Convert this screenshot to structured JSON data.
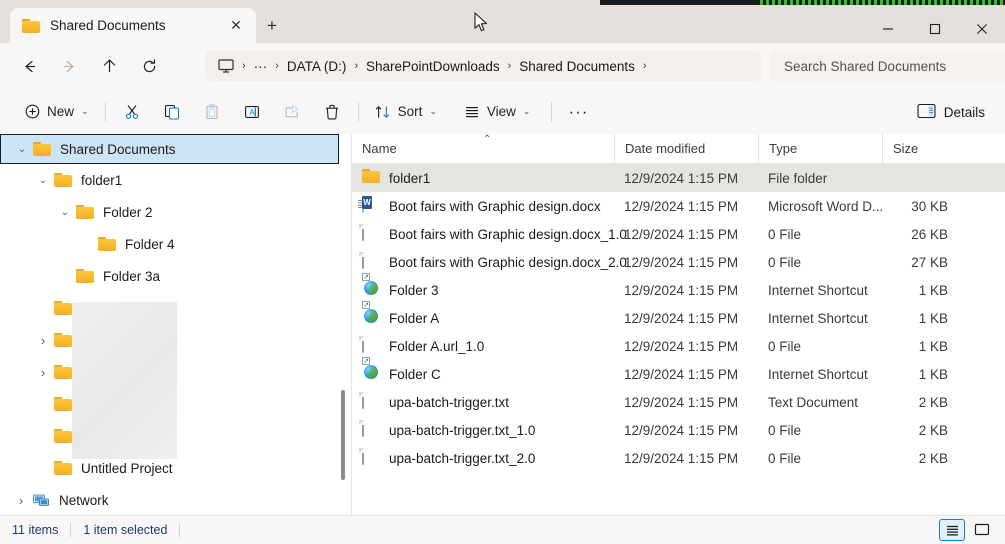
{
  "window": {
    "tab_title": "Shared Documents",
    "tab_folder_icon": "folder-icon",
    "close_tab_icon": "✕",
    "new_tab_icon": "+",
    "minimize_icon": "minimize-icon",
    "maximize_icon": "maximize-icon",
    "close_icon": "close-icon"
  },
  "nav": {
    "back_icon": "←",
    "forward_icon": "→",
    "up_icon": "↑",
    "refresh_icon": "⟳"
  },
  "breadcrumb": {
    "root_icon": "monitor-icon",
    "separator": "›",
    "overflow": "···",
    "items": [
      {
        "label": "DATA (D:)"
      },
      {
        "label": "SharePointDownloads"
      },
      {
        "label": "Shared Documents"
      }
    ]
  },
  "search": {
    "placeholder": "Search Shared Documents",
    "value": ""
  },
  "toolbar": {
    "new_label": "New",
    "new_icon": "plus-circle-icon",
    "cut_icon": "scissors-icon",
    "copy_icon": "copy-icon",
    "paste_icon": "paste-icon",
    "rename_icon": "rename-icon",
    "share_icon": "share-icon",
    "delete_icon": "trash-icon",
    "sort_label": "Sort",
    "sort_icon": "sort-arrows-icon",
    "view_label": "View",
    "view_icon": "view-lines-icon",
    "more_label": "···",
    "details_label": "Details",
    "details_icon": "details-pane-icon",
    "chevron": "⌄"
  },
  "sidebar": {
    "items": [
      {
        "label": "Shared Documents",
        "icon": "folder-icon",
        "indent": 0,
        "chevron": "expanded",
        "selected": true,
        "redacted": false
      },
      {
        "label": "folder1",
        "icon": "folder-icon",
        "indent": 1,
        "chevron": "expanded",
        "selected": false,
        "redacted": false
      },
      {
        "label": "Folder 2",
        "icon": "folder-icon",
        "indent": 2,
        "chevron": "expanded",
        "selected": false,
        "redacted": false
      },
      {
        "label": "Folder 4",
        "icon": "folder-icon",
        "indent": 3,
        "chevron": "none",
        "selected": false,
        "redacted": false
      },
      {
        "label": "Folder 3a",
        "icon": "folder-icon",
        "indent": 2,
        "chevron": "none",
        "selected": false,
        "redacted": false
      },
      {
        "label": "",
        "icon": "folder-icon",
        "indent": 1,
        "chevron": "none",
        "selected": false,
        "redacted": true
      },
      {
        "label": "",
        "icon": "folder-icon",
        "indent": 1,
        "chevron": "collapsed",
        "selected": false,
        "redacted": true
      },
      {
        "label": "",
        "icon": "folder-icon",
        "indent": 1,
        "chevron": "collapsed",
        "selected": false,
        "redacted": true
      },
      {
        "label": "",
        "icon": "folder-icon",
        "indent": 1,
        "chevron": "none",
        "selected": false,
        "redacted": true
      },
      {
        "label": "",
        "icon": "folder-icon",
        "indent": 1,
        "chevron": "none",
        "selected": false,
        "redacted": true
      },
      {
        "label": "Untitled Project",
        "icon": "folder-icon",
        "indent": 1,
        "chevron": "none",
        "selected": false,
        "redacted": false
      },
      {
        "label": "Network",
        "icon": "network-icon",
        "indent": 0,
        "chevron": "collapsed",
        "selected": false,
        "redacted": false
      }
    ]
  },
  "filelist": {
    "columns": [
      {
        "key": "name",
        "label": "Name",
        "sorted": "asc"
      },
      {
        "key": "date",
        "label": "Date modified",
        "sorted": ""
      },
      {
        "key": "type",
        "label": "Type",
        "sorted": ""
      },
      {
        "key": "size",
        "label": "Size",
        "sorted": ""
      }
    ],
    "rows": [
      {
        "name": "folder1",
        "date": "12/9/2024 1:15 PM",
        "type": "File folder",
        "size": "",
        "icon": "folder-icon",
        "selected": true
      },
      {
        "name": "Boot fairs with Graphic design.docx",
        "date": "12/9/2024 1:15 PM",
        "type": "Microsoft Word D...",
        "size": "30 KB",
        "icon": "word-icon",
        "selected": false
      },
      {
        "name": "Boot fairs with Graphic design.docx_1.0",
        "date": "12/9/2024 1:15 PM",
        "type": "0 File",
        "size": "26 KB",
        "icon": "page-icon",
        "selected": false
      },
      {
        "name": "Boot fairs with Graphic design.docx_2.0",
        "date": "12/9/2024 1:15 PM",
        "type": "0 File",
        "size": "27 KB",
        "icon": "page-icon",
        "selected": false
      },
      {
        "name": "Folder 3",
        "date": "12/9/2024 1:15 PM",
        "type": "Internet Shortcut",
        "size": "1 KB",
        "icon": "url-icon",
        "selected": false
      },
      {
        "name": "Folder A",
        "date": "12/9/2024 1:15 PM",
        "type": "Internet Shortcut",
        "size": "1 KB",
        "icon": "url-icon",
        "selected": false
      },
      {
        "name": "Folder A.url_1.0",
        "date": "12/9/2024 1:15 PM",
        "type": "0 File",
        "size": "1 KB",
        "icon": "page-icon",
        "selected": false
      },
      {
        "name": "Folder C",
        "date": "12/9/2024 1:15 PM",
        "type": "Internet Shortcut",
        "size": "1 KB",
        "icon": "url-icon",
        "selected": false
      },
      {
        "name": "upa-batch-trigger.txt",
        "date": "12/9/2024 1:15 PM",
        "type": "Text Document",
        "size": "2 KB",
        "icon": "text-icon",
        "selected": false
      },
      {
        "name": "upa-batch-trigger.txt_1.0",
        "date": "12/9/2024 1:15 PM",
        "type": "0 File",
        "size": "2 KB",
        "icon": "page-icon",
        "selected": false
      },
      {
        "name": "upa-batch-trigger.txt_2.0",
        "date": "12/9/2024 1:15 PM",
        "type": "0 File",
        "size": "2 KB",
        "icon": "page-icon",
        "selected": false
      }
    ]
  },
  "statusbar": {
    "item_count": "11 items",
    "selection": "1 item selected",
    "details_view_icon": "details-view-icon",
    "large_icons_view_icon": "large-icons-view-icon"
  },
  "colors": {
    "window_chrome": "#e4dfda",
    "surface": "#f9f7f5",
    "content": "#ffffff",
    "tree_selection": "#cce4f7",
    "row_selection": "#e6e4e1",
    "accent": "#0f7fd4",
    "folder_yellow": "#f3ae22",
    "status_text": "#1b3a6b"
  }
}
